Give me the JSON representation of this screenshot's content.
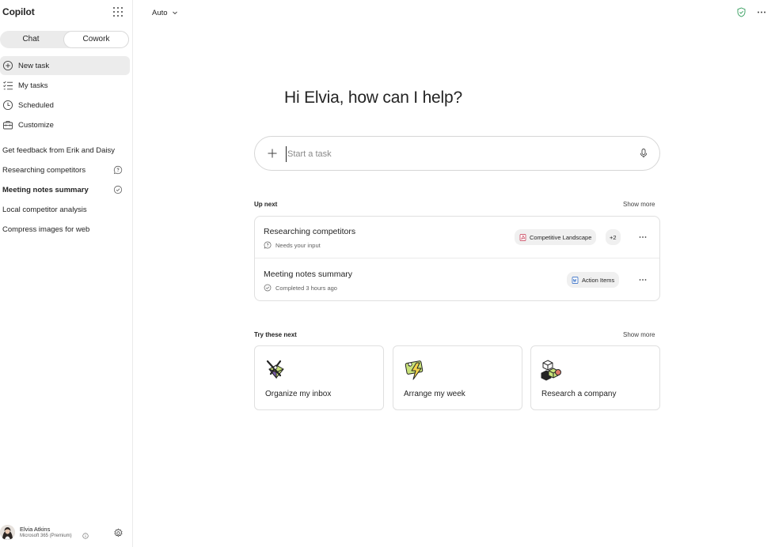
{
  "app": {
    "title": "Copilot"
  },
  "mode_tabs": [
    {
      "label": "Chat",
      "selected": false
    },
    {
      "label": "Cowork",
      "selected": true
    }
  ],
  "nav": [
    {
      "label": "New task",
      "icon": "plus-circle-icon",
      "active": true
    },
    {
      "label": "My tasks",
      "icon": "task-list-icon",
      "active": false
    },
    {
      "label": "Scheduled",
      "icon": "clock-icon",
      "active": false
    },
    {
      "label": "Customize",
      "icon": "toolbox-icon",
      "active": false
    }
  ],
  "tasks": [
    {
      "label": "Get feedback from Erik and Daisy",
      "status_icon": ""
    },
    {
      "label": "Researching competitors",
      "status_icon": "chat-help-icon"
    },
    {
      "label": "Meeting notes summary",
      "status_icon": "check-circle-icon"
    },
    {
      "label": "Local competitor analysis",
      "status_icon": ""
    },
    {
      "label": "Compress images for web",
      "status_icon": ""
    }
  ],
  "profile": {
    "name": "Elvia Atkins",
    "plan": "Microsoft 365 (Premium)"
  },
  "topbar": {
    "model": "Auto"
  },
  "main": {
    "greeting": "Hi Elvia, how can I help?",
    "composer_placeholder": "Start a task",
    "up_next": {
      "label": "Up next",
      "show_more": "Show more",
      "items": [
        {
          "title": "Researching competitors",
          "status": "Needs your input",
          "chip": "Competitive Landscape",
          "extra": "+2"
        },
        {
          "title": "Meeting notes summary",
          "status": "Completed 3 hours ago",
          "chip": "Action Items"
        }
      ]
    },
    "try_next": {
      "label": "Try these next",
      "show_more": "Show more",
      "items": [
        {
          "label": "Organize my inbox",
          "icon": "inbox-illustration-icon"
        },
        {
          "label": "Arrange my week",
          "icon": "calendar-bolt-illustration-icon"
        },
        {
          "label": "Research a company",
          "icon": "cubes-illustration-icon"
        }
      ]
    }
  },
  "colors": {
    "active_nav_bg": "#ececec",
    "shield_green": "#2e9a58",
    "pdf_red": "#c4314b",
    "word_blue": "#185abd"
  }
}
